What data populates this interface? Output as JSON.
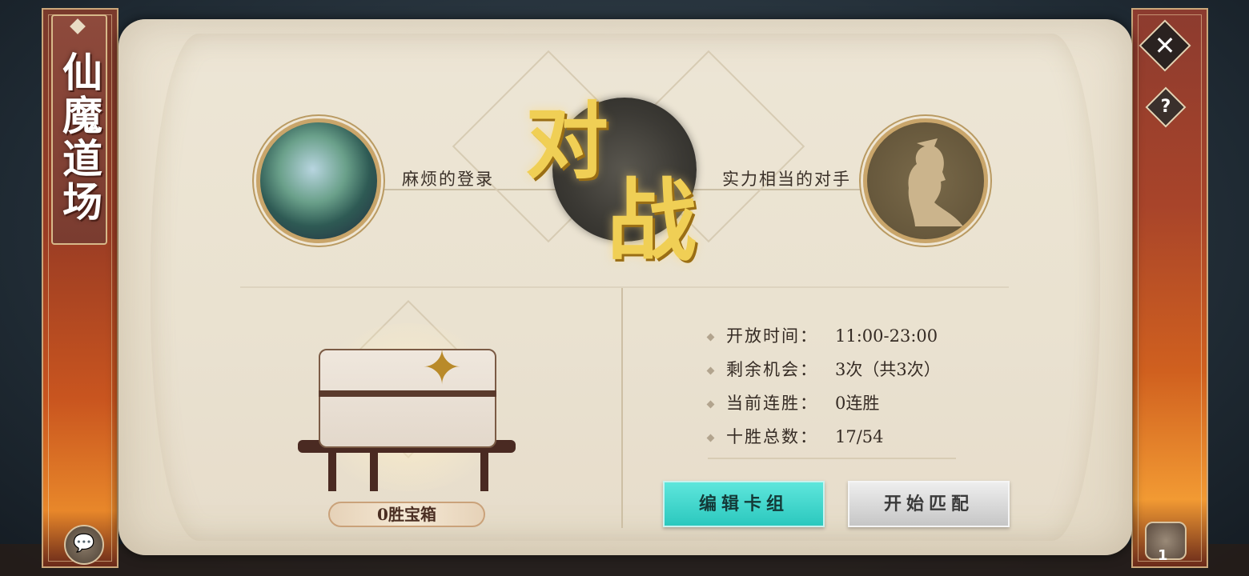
{
  "title": "仙魔道场",
  "player": {
    "name": "麻烦的登录"
  },
  "opponent": {
    "name": "实力相当的对手"
  },
  "versus": {
    "char1": "对",
    "char2": "战"
  },
  "chest": {
    "label": "0胜宝箱"
  },
  "info": [
    {
      "label": "开放时间：",
      "value": "11:00-23:00"
    },
    {
      "label": "剩余机会：",
      "value": "3次（共3次）"
    },
    {
      "label": "当前连胜：",
      "value": "0连胜"
    },
    {
      "label": "十胜总数：",
      "value": "17/54"
    }
  ],
  "buttons": {
    "edit_deck": "编辑卡组",
    "start_match": "开始匹配"
  },
  "controls": {
    "close": "✕",
    "help": "?",
    "chat": "💬",
    "bag_count": "1"
  },
  "colors": {
    "accent_teal": "#2bc8be",
    "gold": "#f0cf55",
    "panel": "#ece4d3",
    "banner": "#9a3c24"
  }
}
